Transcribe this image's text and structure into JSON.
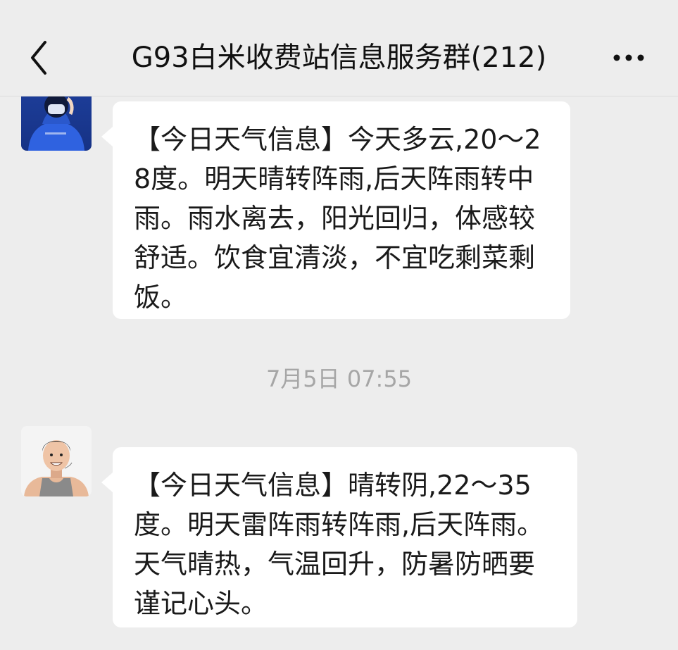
{
  "header": {
    "title": "G93白米收费站信息服务群(212)",
    "back_icon": "chevron-left-icon",
    "more_icon": "more-horizontal-icon"
  },
  "messages": [
    {
      "avatar_icon": "user-avatar-hooded-icon",
      "text": "【今日天气信息】今天多云,20～28度。明天晴转阵雨,后天阵雨转中雨。雨水离去，阳光回归，体感较舒适。饮食宜清淡，不宜吃剩菜剩饭。"
    },
    {
      "avatar_icon": "user-avatar-cartoon-man-icon",
      "text": "【今日天气信息】晴转阴,22～35度。明天雷阵雨转阵雨,后天阵雨。天气晴热，气温回升，防暑防晒要谨记心头。"
    }
  ],
  "timestamp": "7月5日 07:55",
  "colors": {
    "background": "#ededed",
    "bubble": "#ffffff",
    "timestamp": "#a6a6a6"
  }
}
